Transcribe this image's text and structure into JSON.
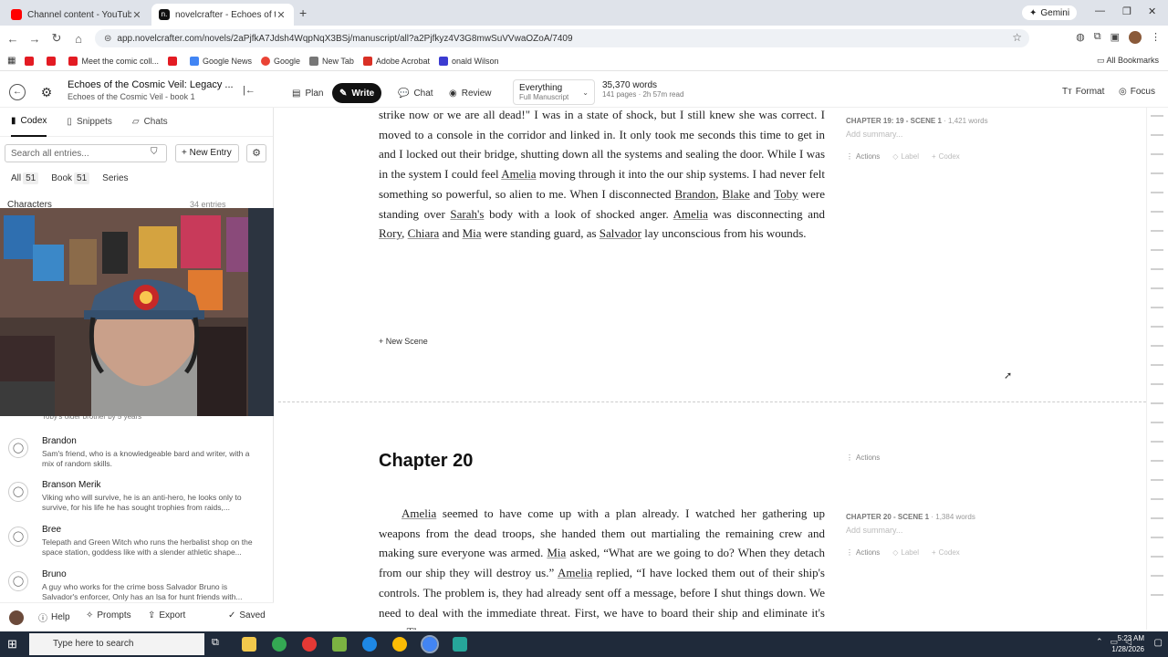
{
  "browser": {
    "tabs": [
      {
        "title": "Channel content - YouTube Stu",
        "active": false,
        "color": "#ff0000"
      },
      {
        "title": "novelcrafter - Echoes of the Co",
        "active": true,
        "color": "#111111"
      }
    ],
    "gemini_label": "Gemini",
    "url": "app.novelcrafter.com/novels/2aPjfkA7Jdsh4WqpNqX3BSj/manuscript/all?a2Pjfkyz4V3G8mwSuVVwaOZoA/7409",
    "bookmarks": [
      {
        "label": "",
        "color": "#e31b23"
      },
      {
        "label": "",
        "color": "#e31b23"
      },
      {
        "label": "Meet the comic coll...",
        "color": "#e31b23"
      },
      {
        "label": "",
        "color": "#e31b23"
      },
      {
        "label": "Google News",
        "color": "#4285f4"
      },
      {
        "label": "Google",
        "color": "#ea4335"
      },
      {
        "label": "New Tab",
        "color": "#777777"
      },
      {
        "label": "Adobe Acrobat",
        "color": "#d93025"
      },
      {
        "label": "onald Wilson",
        "color": "#3b3bd1"
      }
    ],
    "all_bookmarks": "All Bookmarks"
  },
  "app": {
    "book_title": "Echoes of the Cosmic Veil: Legacy ...",
    "book_subtitle": "Echoes of the Cosmic Veil - book 1",
    "modes": [
      "Plan",
      "Write",
      "Chat",
      "Review"
    ],
    "active_mode": "Write",
    "scope": {
      "main": "Everything",
      "sub": "Full Manuscript"
    },
    "words": "35,370 words",
    "pages": "141 pages · 2h 57m read",
    "format_label": "Format",
    "focus_label": "Focus"
  },
  "sidebar": {
    "tabs": [
      "Codex",
      "Snippets",
      "Chats"
    ],
    "search_placeholder": "Search all entries...",
    "new_entry": "New Entry",
    "filters": [
      {
        "label": "All",
        "count": "51"
      },
      {
        "label": "Book",
        "count": "51"
      },
      {
        "label": "Series",
        "count": ""
      }
    ],
    "section": "Characters",
    "section_meta": "34 entries",
    "peek_text": "Toby's older brother by 5 years",
    "entries": [
      {
        "name": "Brandon",
        "desc": "Sam's friend, who is a knowledgeable bard and writer, with a mix of random skills."
      },
      {
        "name": "Branson Merik",
        "desc": "Viking who will survive, he is an anti-hero, he looks only to survive, for his life he has sought trophies from raids,..."
      },
      {
        "name": "Bree",
        "desc": "Telepath and Green Witch who runs the herbalist shop on the space station, goddess like with a slender athletic shape..."
      },
      {
        "name": "Bruno",
        "desc": "A guy who works for the crime boss Salvador Bruno is Salvador's enforcer, Only has an lsa for hunt friends with..."
      }
    ],
    "footer": {
      "help": "Help",
      "prompts": "Prompts",
      "export": "Export",
      "saved": "Saved"
    }
  },
  "editor": {
    "para1": [
      {
        "t": "strike now or we are all dead!\"  I was in a state of shock, but I still knew she was correct. I moved to a console in the corridor and linked in.  It only took me seconds this time to get in and I locked out their bridge, shutting down all the systems and sealing the door.  While I was in the system I could feel "
      },
      {
        "t": "Amelia",
        "n": true
      },
      {
        "t": " moving through it into the our ship systems.  I had never felt something so powerful, so alien to me.  When I disconnected "
      },
      {
        "t": "Brandon",
        "n": true
      },
      {
        "t": ", "
      },
      {
        "t": "Blake",
        "n": true
      },
      {
        "t": " and "
      },
      {
        "t": "Toby",
        "n": true
      },
      {
        "t": " were standing over "
      },
      {
        "t": "Sarah's",
        "n": true
      },
      {
        "t": " body with a look of shocked anger.  "
      },
      {
        "t": "Amelia",
        "n": true
      },
      {
        "t": " was disconnecting and "
      },
      {
        "t": "Rory",
        "n": true
      },
      {
        "t": ", "
      },
      {
        "t": "Chiara",
        "n": true
      },
      {
        "t": " and "
      },
      {
        "t": "Mia",
        "n": true
      },
      {
        "t": " were standing guard, as "
      },
      {
        "t": "Salvador",
        "n": true
      },
      {
        "t": " lay unconscious from his wounds."
      }
    ],
    "new_scene": "New Scene",
    "chapter_title": "Chapter 20",
    "para2": [
      {
        "t": "Amelia",
        "n": true
      },
      {
        "t": " seemed to have come up with a plan already.  I watched her gathering up weapons from the dead troops, she handed them out martialing the remaining crew and making sure everyone was armed.  "
      },
      {
        "t": "Mia",
        "n": true
      },
      {
        "t": " asked, “What are we going to do?  When they detach from our ship they will destroy us.”  "
      },
      {
        "t": "Amelia",
        "n": true
      },
      {
        "t": " replied, “I have locked them out of their ship's controls.  The problem is, they had already sent off a message, before I shut things down.  We need to deal with the immediate threat.  First, we have to board their ship and eliminate it's crew.  Then"
      }
    ],
    "scene19": {
      "label": "CHAPTER 19: 19 - SCENE 1",
      "words": "1,421 words",
      "summary": "Add summary..."
    },
    "scene20": {
      "label": "CHAPTER 20 - SCENE 1",
      "words": "1,384 words",
      "summary": "Add summary..."
    },
    "actions": "Actions",
    "label": "Label",
    "codex": "Codex"
  },
  "taskbar": {
    "search": "Type here to search",
    "time": "5:23 AM",
    "date": "1/28/2026"
  }
}
